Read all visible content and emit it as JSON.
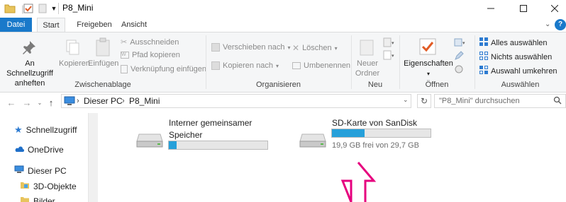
{
  "window": {
    "title": "P8_Mini"
  },
  "tabs": [
    "Datei",
    "Start",
    "Freigeben",
    "Ansicht"
  ],
  "ribbon": {
    "clipboard": {
      "pin_label": "An Schnellzugriff anheften",
      "copy_label": "Kopieren",
      "paste_label": "Einfügen",
      "cut_label": "Ausschneiden",
      "copy_path_label": "Pfad kopieren",
      "paste_shortcut_label": "Verknüpfung einfügen",
      "group_label": "Zwischenablage"
    },
    "organize": {
      "move_to_label": "Verschieben nach",
      "copy_to_label": "Kopieren nach",
      "delete_label": "Löschen",
      "rename_label": "Umbenennen",
      "group_label": "Organisieren"
    },
    "new": {
      "new_folder_label": "Neuer Ordner",
      "group_label": "Neu"
    },
    "open": {
      "properties_label": "Eigenschaften",
      "group_label": "Öffnen"
    },
    "select": {
      "select_all_label": "Alles auswählen",
      "select_none_label": "Nichts auswählen",
      "invert_label": "Auswahl umkehren",
      "group_label": "Auswählen"
    }
  },
  "address": {
    "crumbs": [
      "Dieser PC",
      "P8_Mini"
    ],
    "search_placeholder": "\"P8_Mini\" durchsuchen"
  },
  "nav": {
    "items": [
      "Schnellzugriff",
      "OneDrive",
      "Dieser PC",
      "3D-Objekte",
      "Bilder"
    ]
  },
  "drives": [
    {
      "name_line1": "Interner gemeinsamer",
      "name_line2": "Speicher",
      "used_fraction": 0.08,
      "free_text": ""
    },
    {
      "name_line1": "SD-Karte von SanDisk",
      "name_line2": "",
      "used_fraction": 0.33,
      "free_text": "19,9 GB frei von 29,7 GB"
    }
  ],
  "colors": {
    "accent": "#1979ca",
    "bar_fill": "#26a0da",
    "annotation_arrow": "#e6007e"
  }
}
